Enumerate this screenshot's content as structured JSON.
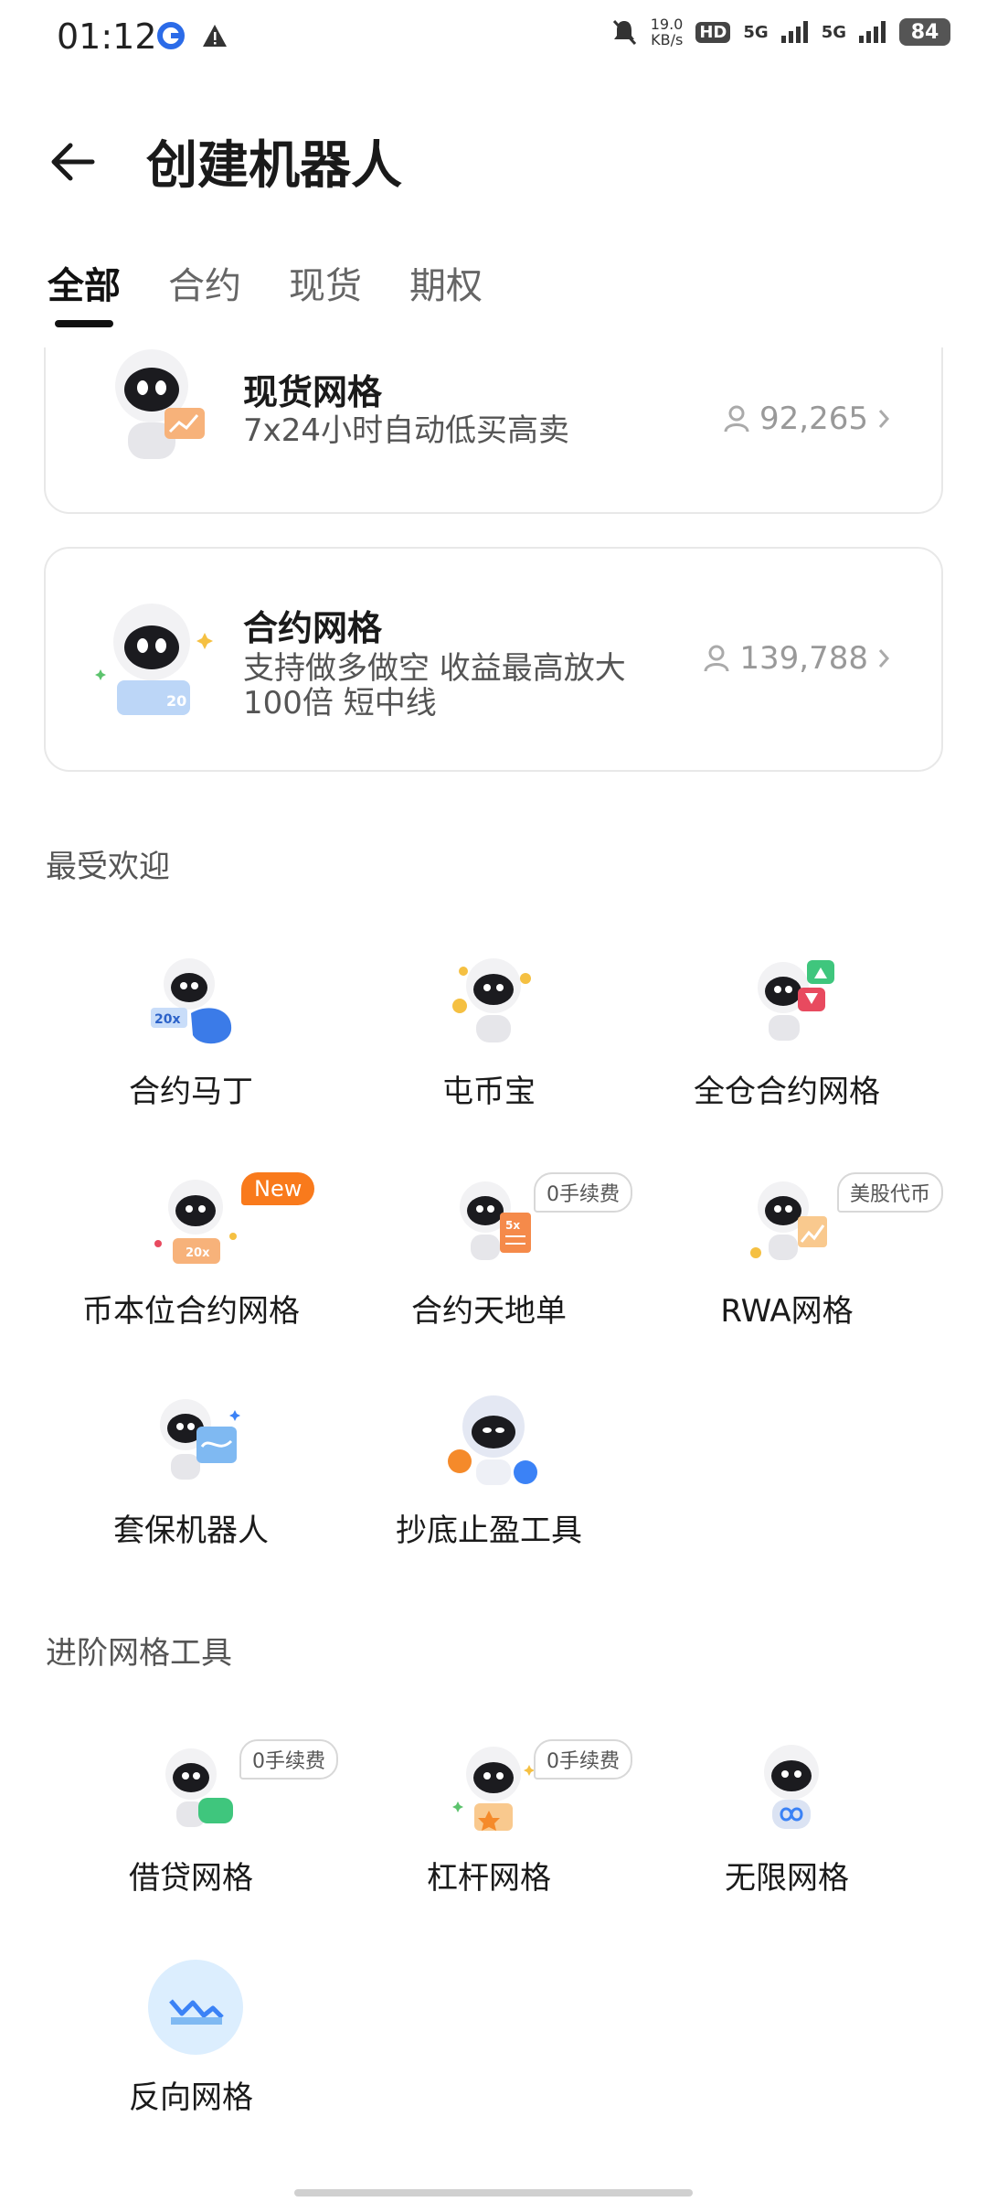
{
  "status_bar": {
    "time": "01:12",
    "net_speed_value": "19.0",
    "net_speed_unit": "KB/s",
    "hd_label": "HD",
    "signal1": "5G",
    "signal2": "5G",
    "battery": "84"
  },
  "header": {
    "title": "创建机器人"
  },
  "tabs": [
    {
      "label": "全部",
      "active": true
    },
    {
      "label": "合约",
      "active": false
    },
    {
      "label": "现货",
      "active": false
    },
    {
      "label": "期权",
      "active": false
    }
  ],
  "featured": [
    {
      "title": "现货网格",
      "desc": "7x24小时自动低买高卖",
      "users": "92,265",
      "icon": "spot-grid-robot-icon"
    },
    {
      "title": "合约网格",
      "desc": "支持做多做空 收益最高放大100倍 短中线",
      "users": "139,788",
      "icon": "futures-grid-robot-icon"
    }
  ],
  "sections": {
    "popular": {
      "title": "最受欢迎",
      "items": [
        {
          "label": "合约马丁",
          "badge": "",
          "icon": "martingale-robot-icon"
        },
        {
          "label": "屯币宝",
          "badge": "",
          "icon": "coin-hoard-robot-icon"
        },
        {
          "label": "全仓合约网格",
          "badge": "",
          "icon": "cross-grid-robot-icon"
        },
        {
          "label": "币本位合约网格",
          "badge": "New",
          "icon": "coin-margined-grid-robot-icon"
        },
        {
          "label": "合约天地单",
          "badge": "0手续费",
          "icon": "tp-sl-robot-icon"
        },
        {
          "label": "RWA网格",
          "badge": "美股代币",
          "icon": "rwa-grid-robot-icon"
        },
        {
          "label": "套保机器人",
          "badge": "",
          "icon": "hedge-robot-icon"
        },
        {
          "label": "抄底止盈工具",
          "badge": "",
          "icon": "dip-buy-robot-icon"
        }
      ]
    },
    "advanced": {
      "title": "进阶网格工具",
      "items": [
        {
          "label": "借贷网格",
          "badge": "0手续费",
          "icon": "loan-grid-robot-icon"
        },
        {
          "label": "杠杆网格",
          "badge": "0手续费",
          "icon": "margin-grid-robot-icon"
        },
        {
          "label": "无限网格",
          "badge": "",
          "icon": "infinity-grid-robot-icon"
        },
        {
          "label": "反向网格",
          "badge": "",
          "icon": "reverse-grid-icon"
        }
      ]
    }
  },
  "colors": {
    "accent_orange": "#f97a1c",
    "robot_body": "#f2f2f4",
    "robot_face": "#1b1b1f",
    "light_blue": "#dceefe",
    "blue": "#3b82f6"
  }
}
